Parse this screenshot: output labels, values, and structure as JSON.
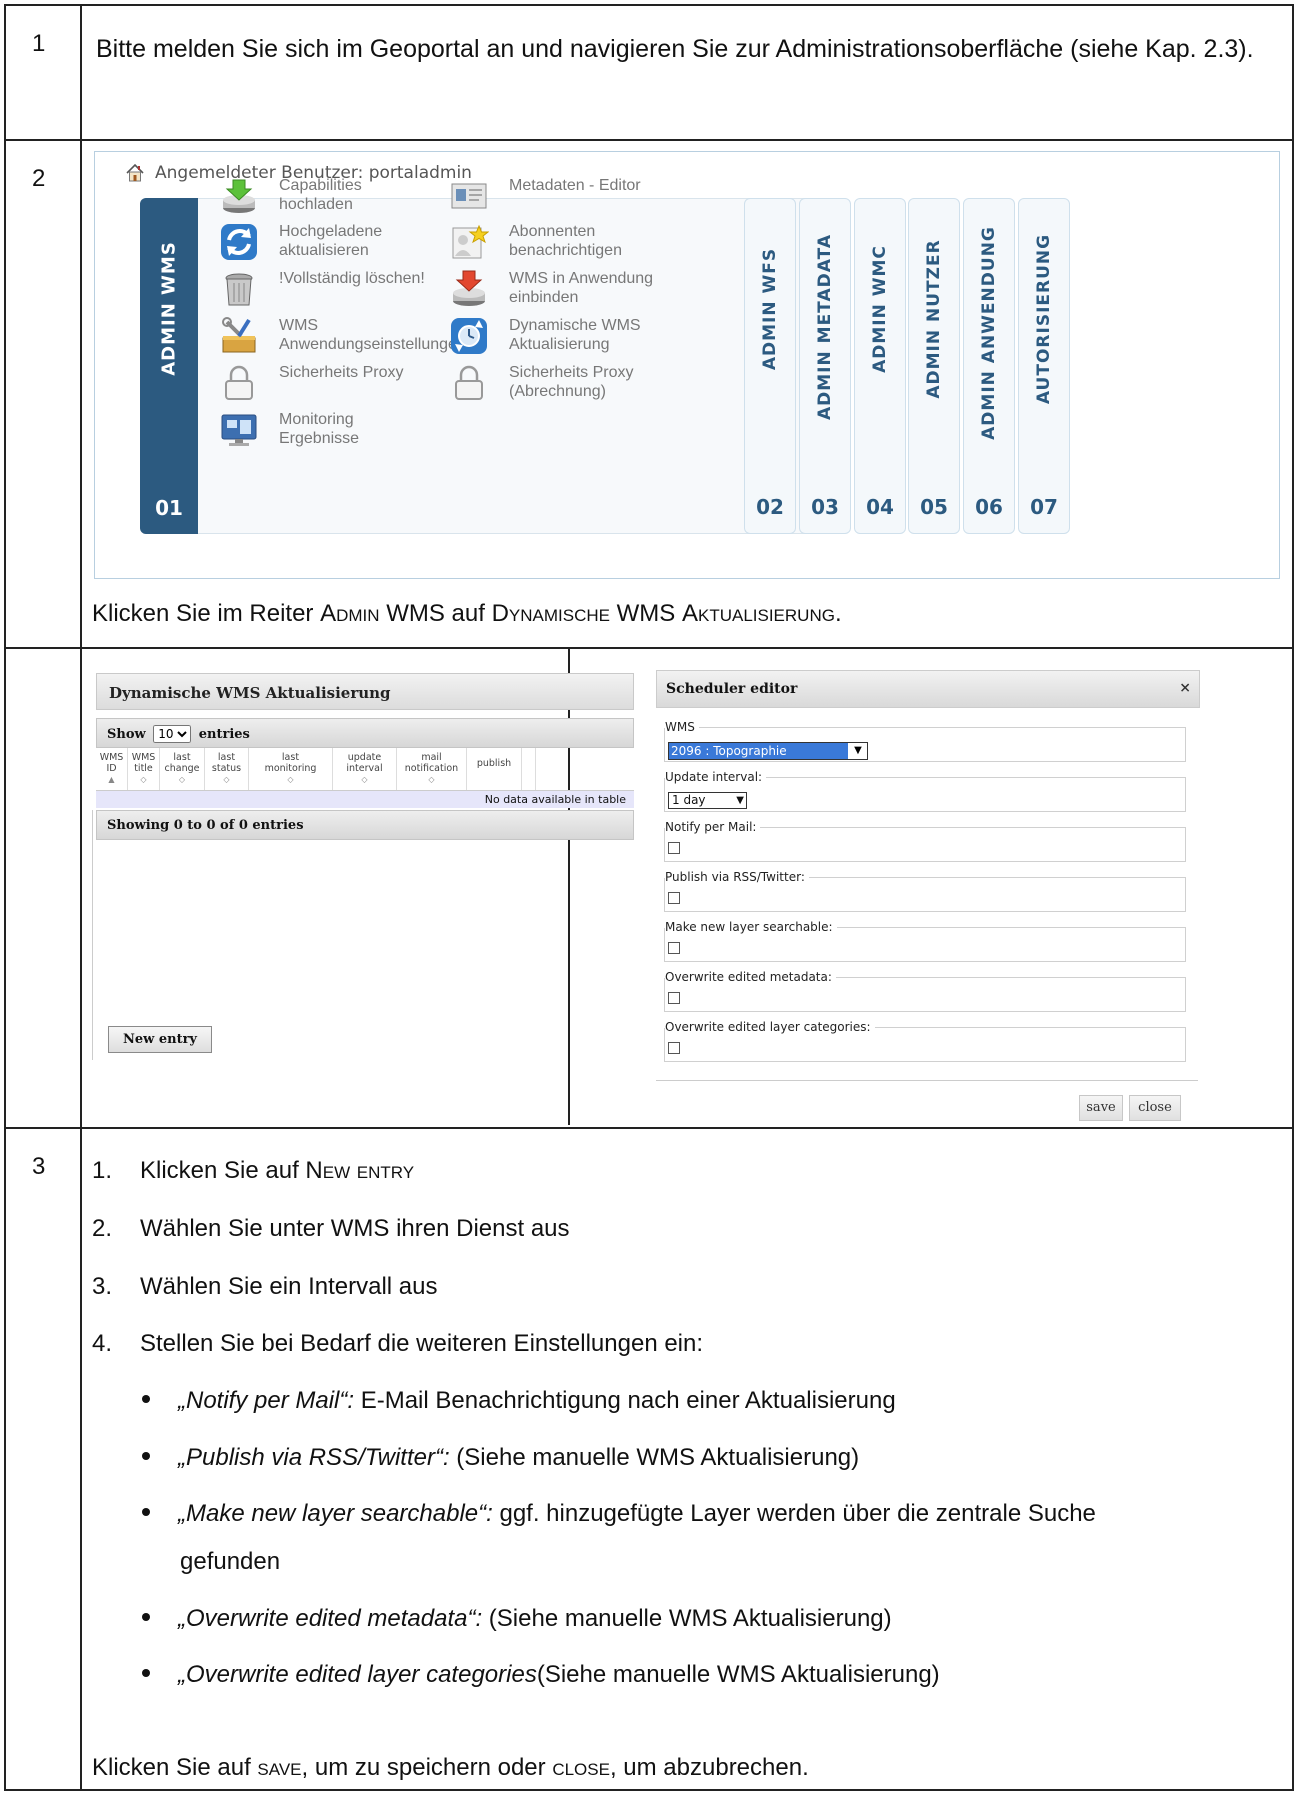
{
  "rows": {
    "r1": {
      "num": "1",
      "text": "Bitte melden Sie sich im Geoportal an und navigieren Sie zur Administrationsoberfläche (siehe Kap. 2.3)."
    },
    "r2": {
      "num": "2"
    },
    "r3": {
      "num": "3"
    }
  },
  "admin": {
    "login_text": "Angemeldeter Benutzer: portaladmin",
    "active_tab": {
      "label": "ADMIN WMS",
      "num": "01"
    },
    "menu_left": [
      {
        "line1": "Capabilities",
        "line2": "hochladen",
        "icon": "upload-disk-icon"
      },
      {
        "line1": "Hochgeladene",
        "line2": "aktualisieren",
        "icon": "refresh-icon"
      },
      {
        "line1": "!Vollständig löschen!",
        "line2": "",
        "icon": "trash-icon"
      },
      {
        "line1": "WMS",
        "line2": "Anwendungseinstellungen",
        "icon": "tools-icon"
      },
      {
        "line1": "Sicherheits Proxy",
        "line2": "",
        "icon": "padlock-icon"
      },
      {
        "line1": "Monitoring",
        "line2": "Ergebnisse",
        "icon": "monitor-icon"
      }
    ],
    "menu_right": [
      {
        "line1": "Metadaten - Editor",
        "line2": "",
        "icon": "metadata-editor-icon"
      },
      {
        "line1": "Abonnenten",
        "line2": "benachrichtigen",
        "icon": "notify-star-icon"
      },
      {
        "line1": "WMS in Anwendung",
        "line2": "einbinden",
        "icon": "embed-download-icon"
      },
      {
        "line1": "Dynamische WMS",
        "line2": "Aktualisierung",
        "icon": "dynamic-refresh-clock-icon"
      },
      {
        "line1": "Sicherheits Proxy",
        "line2": "(Abrechnung)",
        "icon": "padlock-icon"
      }
    ],
    "side_tabs": [
      {
        "label": "ADMIN WFS",
        "num": "02"
      },
      {
        "label": "ADMIN METADATA",
        "num": "03"
      },
      {
        "label": "ADMIN WMC",
        "num": "04"
      },
      {
        "label": "ADMIN NUTZER",
        "num": "05"
      },
      {
        "label": "ADMIN ANWENDUNG",
        "num": "06"
      },
      {
        "label": "AUTORISIERUNG",
        "num": "07"
      }
    ],
    "instruction": {
      "p1": "Klicken Sie im Reiter ",
      "sc1": "Admin",
      "p2": " WMS auf ",
      "sc2": "Dynamische",
      "p3": " WMS ",
      "sc3": "Aktualisierung",
      "p4": "."
    }
  },
  "dyn": {
    "title": "Dynamische WMS Aktualisierung",
    "show_label": "Show",
    "show_value": "10",
    "entries_label": "entries",
    "columns": [
      {
        "line1": "WMS",
        "line2": "ID",
        "sort": "▲"
      },
      {
        "line1": "WMS",
        "line2": "title",
        "sort": "◇"
      },
      {
        "line1": "last",
        "line2": "change",
        "sort": "◇"
      },
      {
        "line1": "last",
        "line2": "status",
        "sort": "◇"
      },
      {
        "line1": "last",
        "line2": "monitoring",
        "sort": "◇"
      },
      {
        "line1": "update",
        "line2": "interval",
        "sort": "◇"
      },
      {
        "line1": "mail",
        "line2": "notification",
        "sort": "◇"
      },
      {
        "line1": "publish",
        "line2": "",
        "sort": ""
      }
    ],
    "empty_text": "No data available in table",
    "footer_text": "Showing 0 to 0 of 0 entries",
    "new_entry_label": "New entry"
  },
  "scheduler": {
    "title": "Scheduler editor",
    "close_glyph": "×",
    "wms_legend": "WMS",
    "wms_value": "2096 : Topographie",
    "interval_legend": "Update interval:",
    "interval_value": "1 day",
    "checkboxes": [
      "Notify per Mail:",
      "Publish via RSS/Twitter:",
      "Make new layer searchable:",
      "Overwrite edited metadata:",
      "Overwrite edited layer categories:"
    ],
    "save_label": "save",
    "close_label": "close"
  },
  "steps": {
    "s1": {
      "n": "1.",
      "text": "Klicken Sie auf ",
      "sc": "New entry"
    },
    "s2": {
      "n": "2.",
      "text": "Wählen Sie unter WMS ihren Dienst aus"
    },
    "s3": {
      "n": "3.",
      "text": "Wählen Sie ein Intervall aus"
    },
    "s4": {
      "n": "4.",
      "text": "Stellen Sie bei Bedarf die weiteren Einstellungen ein:"
    }
  },
  "bullets": [
    {
      "em": "„Notify per Mail“:",
      "text": " E-Mail Benachrichtigung nach einer Aktualisierung"
    },
    {
      "em": "„Publish via RSS/Twitter“:",
      "text": " (Siehe manuelle WMS Aktualisierung)"
    },
    {
      "em": "„Make new layer searchable“:",
      "text": " ggf. hinzugefügte Layer werden über die zentrale Suche",
      "text2": "gefunden"
    },
    {
      "em": "„Overwrite edited metadata“:",
      "text": " (Siehe manuelle WMS Aktualisierung)"
    },
    {
      "em": "„Overwrite edited layer categories",
      "text": "(Siehe manuelle WMS Aktualisierung)"
    }
  ],
  "closing": {
    "p1": "Klicken Sie auf ",
    "sc1": "save",
    "p2": ", um zu speichern oder ",
    "sc2": "close",
    "p3": ", um abzubrechen."
  }
}
